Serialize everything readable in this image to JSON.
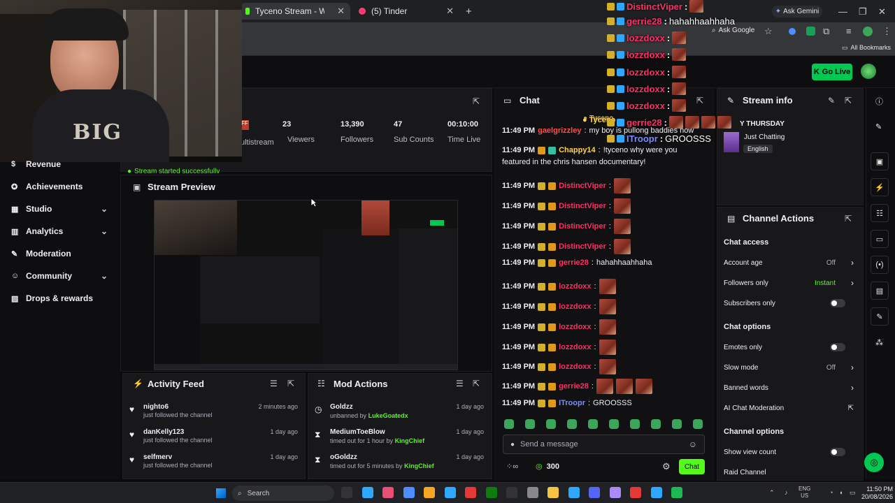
{
  "browser": {
    "tabs": [
      {
        "title": "Tyceno Stream - Watch Live on",
        "icon_color": "#53fc18"
      },
      {
        "title": "(5) Tinder",
        "icon_color": "#fe3c72"
      }
    ],
    "new_tab": "+",
    "ask_gemini": "Ask Gemini",
    "ask_google": "Ask Google",
    "all_bookmarks": "All Bookmarks"
  },
  "header": {
    "go_live": "Go Live"
  },
  "stats": {
    "multistream_label": "ultistream",
    "items": [
      {
        "value": "23",
        "label": "Viewers"
      },
      {
        "value": "13,390",
        "label": "Followers"
      },
      {
        "value": "47",
        "label": "Sub Counts"
      },
      {
        "value": "00:10:00",
        "label": "Time Live"
      }
    ],
    "status": "Stream started successfully"
  },
  "sidebar": {
    "items": [
      {
        "label": "Revenue",
        "icon": "dollar-icon",
        "chevron": false
      },
      {
        "label": "Achievements",
        "icon": "badge-icon",
        "chevron": false
      },
      {
        "label": "Studio",
        "icon": "studio-icon",
        "chevron": true
      },
      {
        "label": "Analytics",
        "icon": "chart-icon",
        "chevron": true
      },
      {
        "label": "Moderation",
        "icon": "wrench-icon",
        "chevron": false
      },
      {
        "label": "Community",
        "icon": "people-icon",
        "chevron": true
      },
      {
        "label": "Drops & rewards",
        "icon": "gift-icon",
        "chevron": false
      }
    ]
  },
  "stream_preview": {
    "title": "Stream Preview"
  },
  "activity_feed": {
    "title": "Activity Feed",
    "items": [
      {
        "name": "nighto6",
        "action": "just followed the channel",
        "time": "2 minutes ago"
      },
      {
        "name": "danKelly123",
        "action": "just followed the channel",
        "time": "1 day ago"
      },
      {
        "name": "selfmerv",
        "action": "just followed the channel",
        "time": "1 day ago"
      }
    ]
  },
  "mod_actions": {
    "title": "Mod Actions",
    "items": [
      {
        "name": "Goldzz",
        "action": "unbanned by",
        "by": "LukeGoatedx",
        "time": "1 day ago",
        "icon": "clock-icon"
      },
      {
        "name": "MediumToeBlow",
        "action": "timed out for 1 hour by",
        "by": "KingChief",
        "time": "1 day ago",
        "icon": "hourglass-icon"
      },
      {
        "name": "oGoldzz",
        "action": "timed out for 5 minutes by",
        "by": "KingChief",
        "time": "1 day ago",
        "icon": "hourglass-icon"
      }
    ]
  },
  "chat": {
    "title": "Chat",
    "pinned_name": "Tyceno",
    "messages": [
      {
        "time": "11:49 PM",
        "user": "gaelgrizzley",
        "color": "#ff4d4d",
        "text": "my boy is pullong baddies now",
        "emotes": 0
      },
      {
        "time": "11:49 PM",
        "user": "Chappy14",
        "color": "#ffd24d",
        "text": "!tyceno why were you",
        "text2": "featured in the chris hansen documentary!",
        "emotes": 0
      },
      {
        "time": "11:49 PM",
        "user": "DistinctViper",
        "color": "#ff2e63",
        "text": "",
        "emotes": 1
      },
      {
        "time": "11:49 PM",
        "user": "DistinctViper",
        "color": "#ff2e63",
        "text": "",
        "emotes": 1
      },
      {
        "time": "11:49 PM",
        "user": "DistinctViper",
        "color": "#ff2e63",
        "text": "",
        "emotes": 1
      },
      {
        "time": "11:49 PM",
        "user": "DistinctViper",
        "color": "#ff2e63",
        "text": "",
        "emotes": 1
      },
      {
        "time": "11:49 PM",
        "user": "gerrie28",
        "color": "#ff2e63",
        "text": "hahahhaahhaha",
        "emotes": 0
      },
      {
        "time": "11:49 PM",
        "user": "lozzdoxx",
        "color": "#ff2e63",
        "text": "",
        "emotes": 1
      },
      {
        "time": "11:49 PM",
        "user": "lozzdoxx",
        "color": "#ff2e63",
        "text": "",
        "emotes": 1
      },
      {
        "time": "11:49 PM",
        "user": "lozzdoxx",
        "color": "#ff2e63",
        "text": "",
        "emotes": 1
      },
      {
        "time": "11:49 PM",
        "user": "lozzdoxx",
        "color": "#ff2e63",
        "text": "",
        "emotes": 1
      },
      {
        "time": "11:49 PM",
        "user": "lozzdoxx",
        "color": "#ff2e63",
        "text": "",
        "emotes": 1
      },
      {
        "time": "11:49 PM",
        "user": "gerrie28",
        "color": "#ff2e63",
        "text": "",
        "emotes": 3
      },
      {
        "time": "11:49 PM",
        "user": "ITroopr",
        "color": "#7b8cff",
        "text": "GROOSSS",
        "emotes": 0
      }
    ],
    "input_placeholder": "Send a message",
    "points": "300",
    "send_label": "Chat"
  },
  "stream_info": {
    "title": "Stream info",
    "stream_title_fragment": "Y THURSDAY",
    "category": "Just Chatting",
    "language": "English"
  },
  "channel_actions": {
    "title": "Channel Actions",
    "sections": [
      {
        "heading": "Chat access",
        "rows": [
          {
            "label": "Account age",
            "value": "Off",
            "kind": "chevron"
          },
          {
            "label": "Followers only",
            "value": "Instant",
            "kind": "chevron"
          },
          {
            "label": "Subscribers only",
            "value": "",
            "kind": "toggle"
          }
        ]
      },
      {
        "heading": "Chat options",
        "rows": [
          {
            "label": "Emotes only",
            "value": "",
            "kind": "toggle"
          },
          {
            "label": "Slow mode",
            "value": "Off",
            "kind": "chevron"
          },
          {
            "label": "Banned words",
            "value": "",
            "kind": "chevron"
          },
          {
            "label": "AI Chat Moderation",
            "value": "",
            "kind": "external"
          }
        ]
      },
      {
        "heading": "Channel options",
        "rows": [
          {
            "label": "Show view count",
            "value": "",
            "kind": "toggle"
          },
          {
            "label": "Raid Channel",
            "value": "",
            "kind": "none"
          }
        ]
      }
    ],
    "accent": "#53fc18"
  },
  "overlay_chat": [
    {
      "user": "DistinctViper",
      "text": ""
    },
    {
      "user": "gerrie28",
      "text": "hahahhaahhaha"
    },
    {
      "user": "lozzdoxx",
      "text": ""
    },
    {
      "user": "lozzdoxx",
      "text": ""
    },
    {
      "user": "lozzdoxx",
      "text": ""
    },
    {
      "user": "lozzdoxx",
      "text": ""
    },
    {
      "user": "lozzdoxx",
      "text": ""
    },
    {
      "user": "gerrie28",
      "text": ""
    },
    {
      "user": "ITroopr",
      "text": "GROOSSS"
    }
  ],
  "overlay_pinned": "Tyceno",
  "webcam_text": "BIG",
  "taskbar": {
    "search": "Search",
    "lang_top": "ENG",
    "lang_bottom": "US",
    "time": "11:50 PM",
    "date": "20/08/2026"
  }
}
